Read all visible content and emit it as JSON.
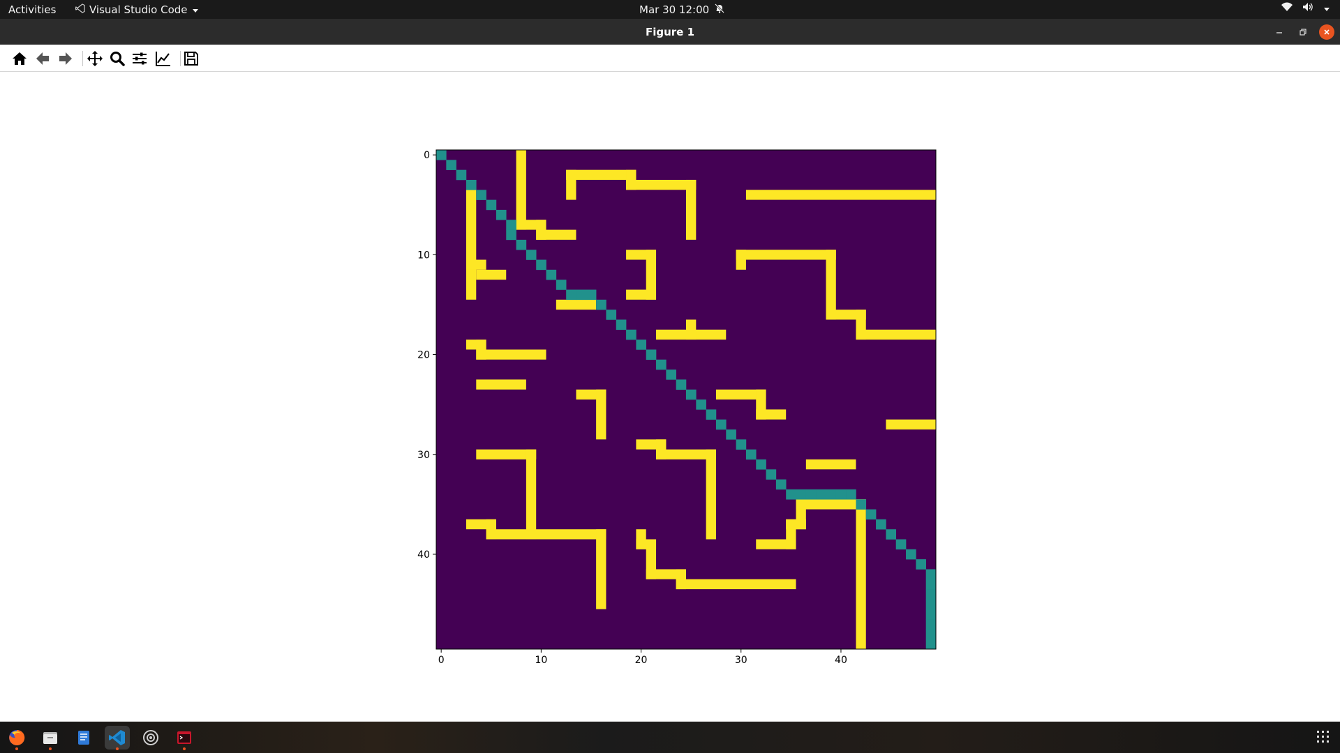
{
  "topbar": {
    "activities": "Activities",
    "app_name": "Visual Studio Code",
    "clock": "Mar 30  12:00",
    "icons": [
      "vscode-icon",
      "dropdown-arrow-icon",
      "notifications-off-icon",
      "wifi-icon",
      "volume-icon",
      "system-menu-arrow-icon"
    ]
  },
  "window": {
    "title": "Figure 1",
    "controls": [
      "minimize-icon",
      "maximize-icon",
      "close-icon"
    ]
  },
  "toolbar": {
    "tools": [
      "home-icon",
      "back-icon",
      "forward-icon",
      "pan-icon",
      "zoom-icon",
      "configure-subplots-icon",
      "edit-axis-icon",
      "save-icon"
    ]
  },
  "taskbar": {
    "apps": [
      "firefox-icon",
      "files-icon",
      "text-editor-icon",
      "vscode-icon",
      "settings-icon",
      "terminal-icon"
    ],
    "show_apps": "app-grid-icon"
  },
  "colors": {
    "background": "#440154",
    "diagonal": "#21918c",
    "wall": "#fde725"
  },
  "chart_data": {
    "type": "heatmap",
    "title": "",
    "xlabel": "",
    "ylabel": "",
    "xticks": [
      0,
      10,
      20,
      30,
      40
    ],
    "yticks": [
      0,
      10,
      20,
      30,
      40
    ],
    "grid": false,
    "rows": 50,
    "cols": 50,
    "colormap": "viridis",
    "value_legend": {
      "0": "background",
      "1": "path",
      "2": "wall"
    },
    "path_cells": [
      [
        0,
        0
      ],
      [
        1,
        1
      ],
      [
        2,
        2
      ],
      [
        3,
        3
      ],
      [
        4,
        4
      ],
      [
        5,
        5
      ],
      [
        6,
        6
      ],
      [
        7,
        7
      ],
      [
        8,
        7
      ],
      [
        9,
        8
      ],
      [
        10,
        9
      ],
      [
        11,
        10
      ],
      [
        12,
        11
      ],
      [
        13,
        12
      ],
      [
        14,
        13
      ],
      [
        14,
        14
      ],
      [
        14,
        15
      ],
      [
        15,
        16
      ],
      [
        16,
        17
      ],
      [
        17,
        18
      ],
      [
        18,
        19
      ],
      [
        19,
        20
      ],
      [
        20,
        21
      ],
      [
        21,
        22
      ],
      [
        22,
        23
      ],
      [
        23,
        24
      ],
      [
        24,
        25
      ],
      [
        25,
        26
      ],
      [
        26,
        27
      ],
      [
        27,
        28
      ],
      [
        28,
        29
      ],
      [
        29,
        30
      ],
      [
        30,
        31
      ],
      [
        31,
        32
      ],
      [
        32,
        33
      ],
      [
        33,
        34
      ],
      [
        34,
        35
      ],
      [
        34,
        36
      ],
      [
        34,
        37
      ],
      [
        34,
        38
      ],
      [
        34,
        39
      ],
      [
        34,
        40
      ],
      [
        34,
        41
      ],
      [
        35,
        42
      ],
      [
        36,
        43
      ],
      [
        37,
        44
      ],
      [
        38,
        45
      ],
      [
        39,
        46
      ],
      [
        40,
        47
      ],
      [
        41,
        48
      ],
      [
        42,
        49
      ],
      [
        43,
        49
      ],
      [
        44,
        49
      ],
      [
        45,
        49
      ],
      [
        46,
        49
      ],
      [
        47,
        49
      ],
      [
        48,
        49
      ],
      [
        49,
        49
      ]
    ],
    "walls": [
      [
        [
          0,
          8
        ],
        [
          7,
          8
        ],
        [
          7,
          10
        ],
        [
          8,
          10
        ],
        [
          8,
          13
        ]
      ],
      [
        [
          4,
          13
        ],
        [
          2,
          13
        ],
        [
          2,
          19
        ]
      ],
      [
        [
          2,
          19
        ],
        [
          3,
          19
        ],
        [
          3,
          25
        ],
        [
          8,
          25
        ]
      ],
      [
        [
          4,
          3
        ],
        [
          14,
          3
        ]
      ],
      [
        [
          11,
          3
        ],
        [
          11,
          4
        ]
      ],
      [
        [
          12,
          4
        ],
        [
          12,
          6
        ]
      ],
      [
        [
          10,
          19
        ],
        [
          10,
          21
        ],
        [
          14,
          21
        ],
        [
          14,
          19
        ]
      ],
      [
        [
          15,
          12
        ],
        [
          15,
          15
        ]
      ],
      [
        [
          4,
          31
        ],
        [
          4,
          49
        ]
      ],
      [
        [
          11,
          30
        ],
        [
          10,
          30
        ],
        [
          10,
          39
        ],
        [
          16,
          39
        ],
        [
          16,
          42
        ],
        [
          18,
          42
        ],
        [
          18,
          49
        ]
      ],
      [
        [
          19,
          3
        ],
        [
          19,
          4
        ],
        [
          20,
          4
        ],
        [
          20,
          10
        ]
      ],
      [
        [
          18,
          22
        ],
        [
          18,
          28
        ]
      ],
      [
        [
          17,
          25
        ],
        [
          18,
          25
        ]
      ],
      [
        [
          23,
          4
        ],
        [
          23,
          8
        ]
      ],
      [
        [
          24,
          14
        ],
        [
          24,
          16
        ],
        [
          28,
          16
        ]
      ],
      [
        [
          24,
          28
        ],
        [
          24,
          32
        ],
        [
          26,
          32
        ],
        [
          26,
          34
        ]
      ],
      [
        [
          27,
          45
        ],
        [
          27,
          49
        ]
      ],
      [
        [
          30,
          4
        ],
        [
          30,
          9
        ],
        [
          38,
          9
        ]
      ],
      [
        [
          29,
          20
        ],
        [
          29,
          22
        ],
        [
          30,
          22
        ],
        [
          30,
          27
        ],
        [
          38,
          27
        ]
      ],
      [
        [
          31,
          37
        ],
        [
          31,
          41
        ]
      ],
      [
        [
          37,
          3
        ],
        [
          37,
          5
        ],
        [
          38,
          5
        ],
        [
          38,
          16
        ],
        [
          45,
          16
        ]
      ],
      [
        [
          38,
          20
        ],
        [
          39,
          20
        ],
        [
          39,
          21
        ],
        [
          42,
          21
        ],
        [
          42,
          24
        ],
        [
          43,
          24
        ],
        [
          43,
          35
        ]
      ],
      [
        [
          39,
          32
        ],
        [
          39,
          35
        ],
        [
          37,
          35
        ],
        [
          37,
          36
        ],
        [
          35,
          36
        ],
        [
          35,
          42
        ],
        [
          49,
          42
        ]
      ]
    ]
  }
}
